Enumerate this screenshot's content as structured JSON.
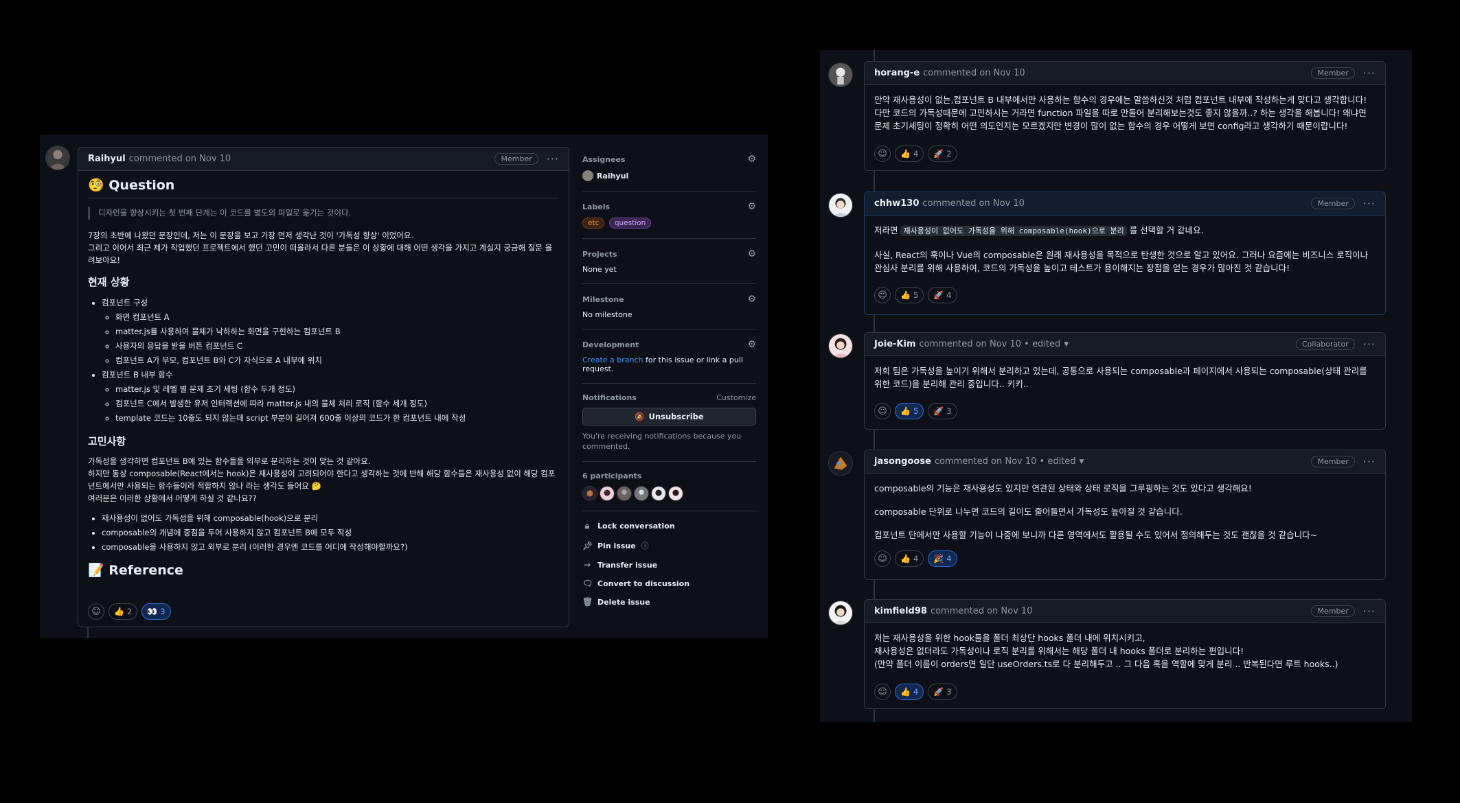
{
  "left": {
    "main_comment": {
      "author": "Raihyul",
      "meta": "commented on Nov 10",
      "role": "Member",
      "heading": "🧐 Question",
      "quote": "디자인을 향상시키는 첫 번째 단계는 이 코드를 별도의 파일로 옮기는 것이다.",
      "intro_line1": "7장의 초반에 나왔던 문장인데, 저는 이 문장을 보고 가장 먼저 생각난 것이 '가독성 향상' 이었어요.",
      "intro_line2": "그리고 이어서 최근 제가 작업했던 프로젝트에서 했던 고민이 떠올라서 다른 분들은 이 상황에 대해 어떤 생각을 가지고 계실지 궁금해 질문 올려보아요!",
      "situation_heading": "현재 상황",
      "situation": {
        "item1": "컴포넌트 구성",
        "item1_sub": [
          "화면 컴포넌트 A",
          "matter.js를 사용하여 물체가 낙하하는 화면을 구현하는 컴포넌트 B",
          "사용자의 응답을 받을 버튼 컴포넌트 C",
          "컴포넌트 A가 부모, 컴포넌트 B와 C가 자식으로 A 내부에 위치"
        ],
        "item2": "컴포넌트 B 내부 함수",
        "item2_sub": [
          "matter.js 및 레벨 별 문제 초기 세팅 (함수 두개 정도)",
          "컴포넌트 C에서 발생한 유저 인터렉션에 따라 matter.js 내의 물체 처리 로직 (함수 세개 정도)",
          "template 코드는 10줄도 되지 않는데 script 부분이 길어져 600줄 이상의 코드가 한 컴포넌트 내에 작성"
        ]
      },
      "concern_heading": "고민사항",
      "concern_line1": "가독성을 생각하면 컴포넌트 B에 있는 함수들을 외부로 분리하는 것이 맞는 것 같아요.",
      "concern_line2": "하지만 동상 composable(React에서는 hook)은 재사용성이 고려되어야 한다고 생각하는 것에 반해 해당 함수들은 재사용성 없이 해당 컴포넌트에서만 사용되는 함수들이라 적합하지 않나 라는 생각도 들어요 🤔",
      "concern_line3": "여러분은 이러한 상황에서 어떻게 하실 것 같나요??",
      "options": [
        "재사용성이 없어도 가독성을 위해 composable(hook)으로 분리",
        "composable의 개념에 중점을 두어 사용하지 않고 컴포넌트 B에 모두 작성",
        "composable을 사용하지 않고 외부로 분리 (이러한 경우엔 코드를 어디에 작성해야할까요?)"
      ],
      "reference_heading": "📝 Reference",
      "reactions": [
        {
          "emoji": "👍",
          "count": "2",
          "active": false
        },
        {
          "emoji": "👀",
          "count": "3",
          "active": true
        }
      ]
    },
    "sidebar": {
      "assignees_title": "Assignees",
      "assignee": "Raihyul",
      "labels_title": "Labels",
      "labels": [
        {
          "name": "etc",
          "color": "#f0883e"
        },
        {
          "name": "question",
          "color": "#d2a8ff"
        }
      ],
      "projects_title": "Projects",
      "projects_value": "None yet",
      "milestone_title": "Milestone",
      "milestone_value": "No milestone",
      "development_title": "Development",
      "development_link": "Create a branch",
      "development_text": " for this issue or link a pull request.",
      "notifications_title": "Notifications",
      "customize": "Customize",
      "unsubscribe": "Unsubscribe",
      "notif_note": "You're receiving notifications because you commented.",
      "participants_title": "6 participants",
      "actions": {
        "lock": "Lock conversation",
        "pin": "Pin issue",
        "transfer": "Transfer issue",
        "convert": "Convert to discussion",
        "delete": "Delete issue"
      }
    }
  },
  "right": {
    "comments": [
      {
        "author": "horang-e",
        "meta": "commented on Nov 10",
        "role": "Member",
        "body": [
          "만약 재사용성이 없는,컴포넌트 B 내부에서만 사용하는 함수의 경우에는 말씀하신것 처럼 컴포넌트 내부에 작성하는게 맞다고 생각합니다! 다만 코드의 가독성때문에 고민하시는 거라면 function 파일을 따로 만들어 분리해보는것도 좋지 않을까..? 하는 생각을 해봅니다! 왜냐면 문제 초기세팅이 정확히 어떤 의도인지는 모르겠지만 변경이 많이 없는 함수의 경우 어떻게 보면 config라고 생각하기 때문이랍니다!"
        ],
        "reactions": [
          {
            "emoji": "👍",
            "count": "4",
            "active": false
          },
          {
            "emoji": "🚀",
            "count": "2",
            "active": false
          }
        ]
      },
      {
        "author": "chhw130",
        "meta": "commented on Nov 10",
        "role": "Member",
        "body_prefix": "저라면 ",
        "body_code": "재사용성이 없어도 가독성을 위해 composable(hook)으로 분리",
        "body_suffix": " 를 선택할 거 같네요.",
        "body2": "사실, React의 훅이나 Vue의 composable은 원래 재사용성을 목적으로 탄생한 것으로 알고 있어요. 그러나 요즘에는 비즈니스 로직이나 관심사 분리를 위해 사용하여, 코드의 가독성을 높이고 테스트가 용이해지는 장점을 얻는 경우가 많아진 것 같습니다!",
        "reactions": [
          {
            "emoji": "👍",
            "count": "5",
            "active": false
          },
          {
            "emoji": "🚀",
            "count": "4",
            "active": false
          }
        ]
      },
      {
        "author": "Joie-Kim",
        "meta": "commented on Nov 10 • edited",
        "role": "Collaborator",
        "body": [
          "저희 팀은 가독성을 높이기 위해서 분리하고 있는데, 공통으로 사용되는 composable과 페이지에서 사용되는 composable(상태 관리를 위한 코드)을 분리해 관리 중입니다.. 키키.."
        ],
        "reactions": [
          {
            "emoji": "👍",
            "count": "5",
            "active": true
          },
          {
            "emoji": "🚀",
            "count": "3",
            "active": false
          }
        ]
      },
      {
        "author": "jasongoose",
        "meta": "commented on Nov 10 • edited",
        "role": "Member",
        "body": [
          "composable의 기능은 재사용성도 있지만 연관된 상태와 상태 로직을 그루핑하는 것도 있다고 생각해요!",
          "composable 단위로 나누면 코드의 길이도 줄어들면서 가독성도 높아질 것 같습니다.",
          "컴포넌트 단에서만 사용할 기능이 나중에 보니까 다른 영역에서도 활용될 수도 있어서 정의해두는 것도 괜찮을 것 같습니다~"
        ],
        "reactions": [
          {
            "emoji": "👍",
            "count": "4",
            "active": false
          },
          {
            "emoji": "🎉",
            "count": "4",
            "active": true
          }
        ]
      },
      {
        "author": "kimfield98",
        "meta": "commented on Nov 10",
        "role": "Member",
        "body": [
          "저는 재사용성을 위한 hook들을 폴더 최상단 hooks 폴더 내에 위치시키고,",
          "재사용성은 없더라도 가독성이나 로직 분리를 위해서는 해당 폴더 내 hooks 폴더로 분리하는 편입니다!",
          "(만약 폴더 이름이 orders면 일단 useOrders.ts로 다 분리해두고 .. 그 다음 혹을 역할에 맞게 분리 .. 반복된다면 루트 hooks..)"
        ],
        "reactions": [
          {
            "emoji": "👍",
            "count": "4",
            "active": true
          },
          {
            "emoji": "🚀",
            "count": "3",
            "active": false
          }
        ]
      }
    ]
  },
  "colors": {
    "panel_bg": "#0d1117",
    "border": "#30363d",
    "link": "#4493f8",
    "reaction_active": "#122850"
  }
}
